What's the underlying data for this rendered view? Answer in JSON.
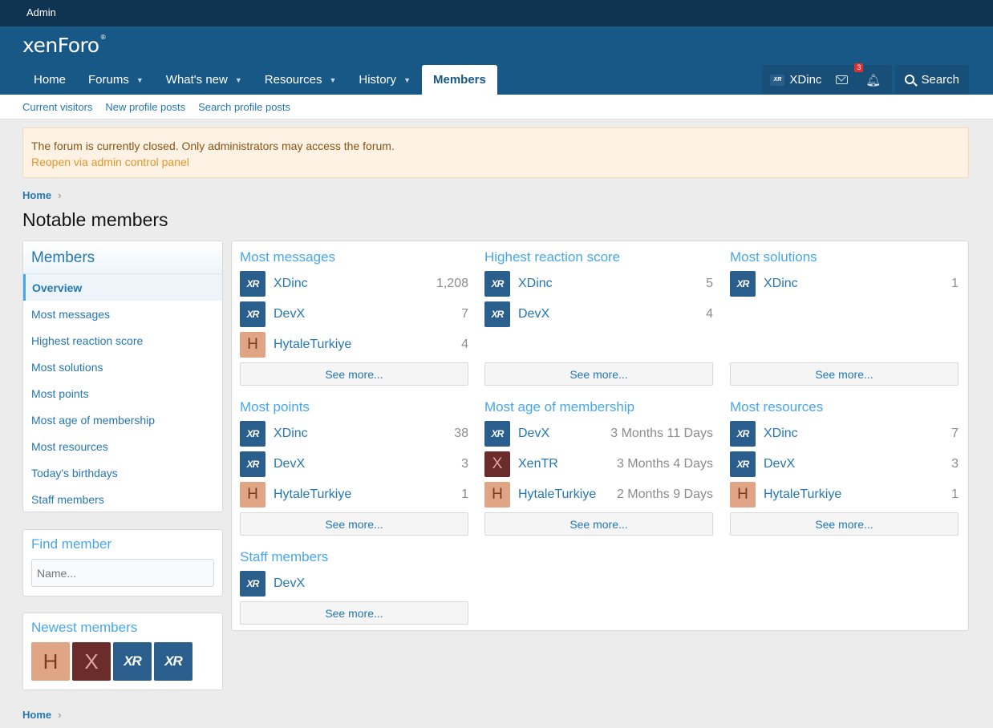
{
  "admin_bar": {
    "label": "Admin"
  },
  "header": {
    "logo": "xenForo",
    "logo_mark": "®"
  },
  "nav": [
    {
      "label": "Home",
      "caret": false
    },
    {
      "label": "Forums",
      "caret": true
    },
    {
      "label": "What's new",
      "caret": true
    },
    {
      "label": "Resources",
      "caret": true
    },
    {
      "label": "History",
      "caret": true
    },
    {
      "label": "Members",
      "caret": false,
      "active": true
    }
  ],
  "account": {
    "username": "XDinc",
    "avatar_text": "XR",
    "alerts_count": "3"
  },
  "search": {
    "label": "Search"
  },
  "subnav": [
    "Current visitors",
    "New profile posts",
    "Search profile posts"
  ],
  "notice": {
    "text": "The forum is currently closed. Only administrators may access the forum.",
    "link": "Reopen via admin control panel"
  },
  "breadcrumb": {
    "home": "Home",
    "sep": "›"
  },
  "page_title": "Notable members",
  "sidebar": {
    "title": "Members",
    "items": [
      "Overview",
      "Most messages",
      "Highest reaction score",
      "Most solutions",
      "Most points",
      "Most age of membership",
      "Most resources",
      "Today's birthdays",
      "Staff members"
    ]
  },
  "find_member": {
    "title": "Find member",
    "placeholder": "Name..."
  },
  "newest_members": {
    "title": "Newest members",
    "avatars": [
      {
        "type": "h",
        "text": "H"
      },
      {
        "type": "x",
        "text": "X"
      },
      {
        "type": "xdinc",
        "text": "XR"
      },
      {
        "type": "xdinc",
        "text": "XR"
      }
    ]
  },
  "see_more": "See more...",
  "sections": [
    {
      "title": "Most messages",
      "rows": [
        {
          "name": "XDinc",
          "value": "1,208",
          "av": "xdinc",
          "av_text": "XR"
        },
        {
          "name": "DevX",
          "value": "7",
          "av": "xdinc",
          "av_text": "XR"
        },
        {
          "name": "HytaleTurkiye",
          "value": "4",
          "av": "h",
          "av_text": "H"
        }
      ]
    },
    {
      "title": "Highest reaction score",
      "rows": [
        {
          "name": "XDinc",
          "value": "5",
          "av": "xdinc",
          "av_text": "XR"
        },
        {
          "name": "DevX",
          "value": "4",
          "av": "xdinc",
          "av_text": "XR"
        }
      ]
    },
    {
      "title": "Most solutions",
      "rows": [
        {
          "name": "XDinc",
          "value": "1",
          "av": "xdinc",
          "av_text": "XR"
        }
      ]
    },
    {
      "title": "Most points",
      "rows": [
        {
          "name": "XDinc",
          "value": "38",
          "av": "xdinc",
          "av_text": "XR"
        },
        {
          "name": "DevX",
          "value": "3",
          "av": "xdinc",
          "av_text": "XR"
        },
        {
          "name": "HytaleTurkiye",
          "value": "1",
          "av": "h",
          "av_text": "H"
        }
      ]
    },
    {
      "title": "Most age of membership",
      "rows": [
        {
          "name": "DevX",
          "value": "3 Months 11 Days",
          "av": "xdinc",
          "av_text": "XR"
        },
        {
          "name": "XenTR",
          "value": "3 Months 4 Days",
          "av": "x",
          "av_text": "X"
        },
        {
          "name": "HytaleTurkiye",
          "value": "2 Months 9 Days",
          "av": "h",
          "av_text": "H"
        }
      ]
    },
    {
      "title": "Most resources",
      "rows": [
        {
          "name": "XDinc",
          "value": "7",
          "av": "xdinc",
          "av_text": "XR"
        },
        {
          "name": "DevX",
          "value": "3",
          "av": "xdinc",
          "av_text": "XR"
        },
        {
          "name": "HytaleTurkiye",
          "value": "1",
          "av": "h",
          "av_text": "H"
        }
      ]
    },
    {
      "title": "Staff members",
      "rows": [
        {
          "name": "DevX",
          "value": "",
          "av": "xdinc",
          "av_text": "XR"
        }
      ]
    }
  ]
}
